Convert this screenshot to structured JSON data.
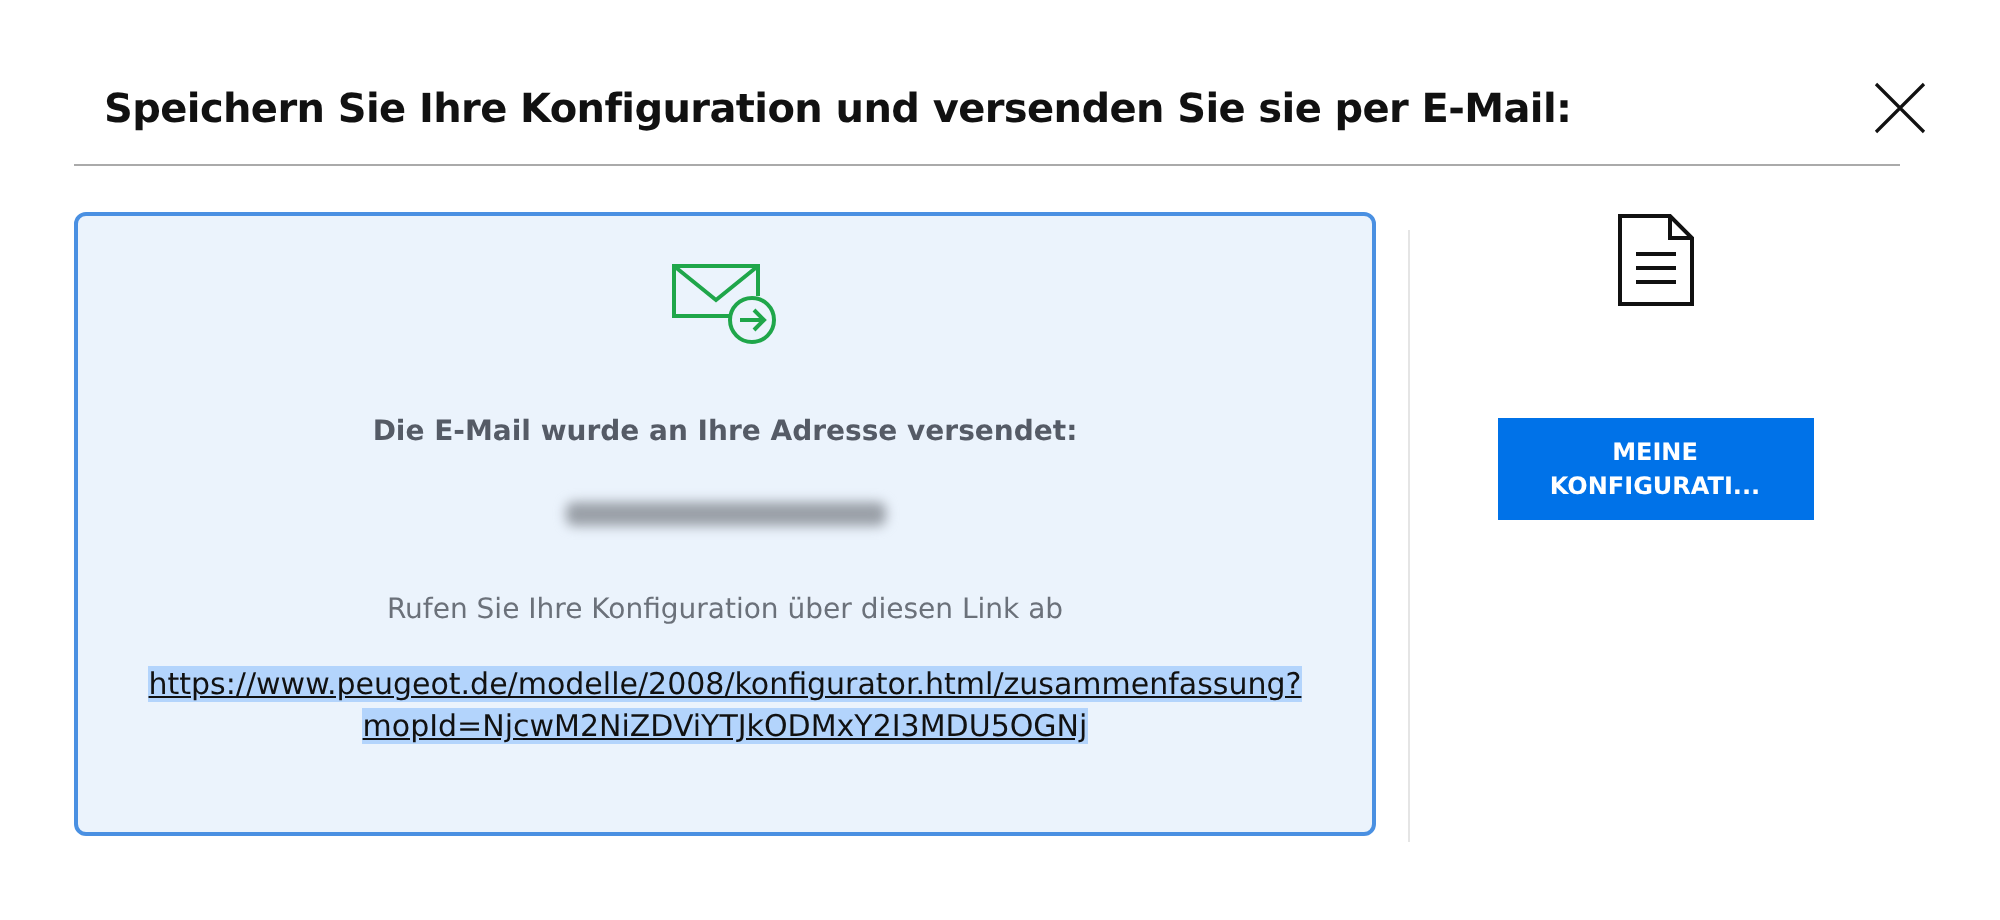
{
  "dialog": {
    "title": "Speichern Sie Ihre Konfiguration und versenden Sie sie per E-Mail:"
  },
  "confirmation": {
    "heading": "Die E-Mail wurde an Ihre Adresse versendet:",
    "instruction": "Rufen Sie Ihre Konfiguration über diesen Link ab",
    "link": {
      "text": "https://www.peugeot.de/modelle/2008/konfigurator.html/zusammenfassung?mopId=NjcwM2NiZDViYTJkODMxY2I3MDU5OGNj",
      "highlighted": true
    }
  },
  "download": {
    "button": "MEINE KONFIGURATI..."
  }
}
